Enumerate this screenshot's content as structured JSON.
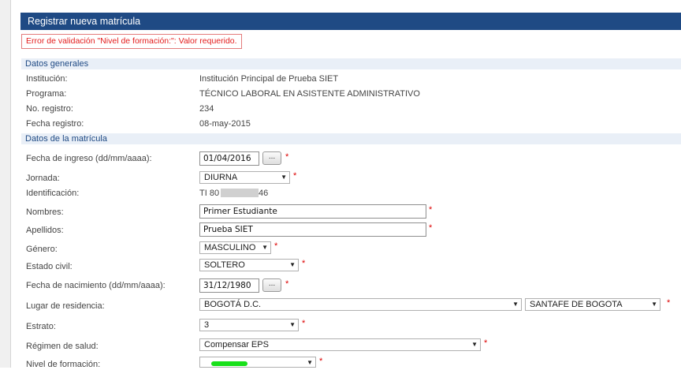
{
  "header": {
    "title": "Registrar nueva matrícula"
  },
  "error": {
    "message": "Error de validación \"Nivel de formación:\": Valor requerido."
  },
  "sections": {
    "general": "Datos generales",
    "enrollment": "Datos de la matrícula"
  },
  "general": {
    "institution_label": "Institución:",
    "institution_value": "Institución Principal de Prueba SIET",
    "program_label": "Programa:",
    "program_value": "TÉCNICO LABORAL EN ASISTENTE ADMINISTRATIVO",
    "registry_label": "No. registro:",
    "registry_value": "234",
    "registry_date_label": "Fecha registro:",
    "registry_date_value": "08-may-2015"
  },
  "form": {
    "entry_date_label": "Fecha de ingreso (dd/mm/aaaa):",
    "entry_date_value": "01/04/2016",
    "date_button": "...",
    "shift_label": "Jornada:",
    "shift_value": "DIURNA",
    "id_label": "Identificación:",
    "id_prefix": "TI 80",
    "id_suffix": "46",
    "names_label": "Nombres:",
    "names_value": "Primer Estudiante",
    "surnames_label": "Apellidos:",
    "surnames_value": "Prueba SIET",
    "gender_label": "Género:",
    "gender_value": "MASCULINO",
    "civil_label": "Estado civil:",
    "civil_value": "SOLTERO",
    "birth_label": "Fecha de nacimiento (dd/mm/aaaa):",
    "birth_value": "31/12/1980",
    "residence_label": "Lugar de residencia:",
    "residence_dept": "BOGOTÁ D.C.",
    "residence_city": "SANTAFE DE BOGOTA",
    "stratum_label": "Estrato:",
    "stratum_value": "3",
    "health_label": "Régimen de salud:",
    "health_value": "Compensar EPS",
    "level_label": "Nivel de formación:",
    "level_value": ""
  },
  "required_mark": "*",
  "dropdown_icon": "▼",
  "colors": {
    "header": "#1f4a84",
    "error": "#e31c1c",
    "required": "#dd0000",
    "highlight": "#18e01a"
  }
}
